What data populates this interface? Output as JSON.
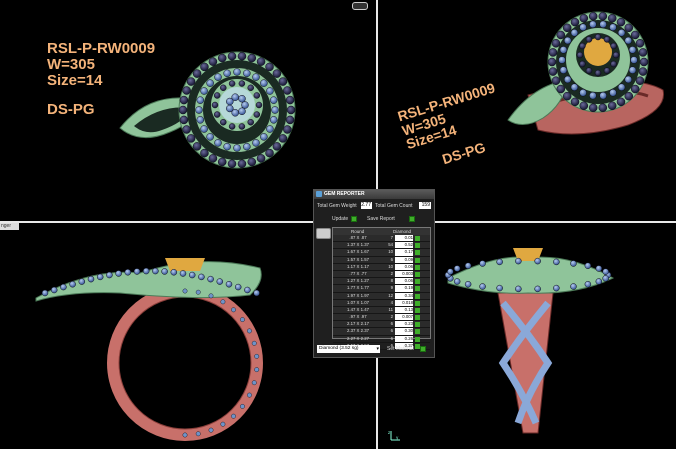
{
  "labels": {
    "topleft": {
      "code": "RSL-P-RW0009",
      "weight": "W=305",
      "size": "Size=14",
      "ds": "DS-PG"
    },
    "topright": {
      "code": "RSL-P-RW0009",
      "weight": "W=305",
      "size": "Size=14",
      "ds": "DS-PG"
    }
  },
  "viewport_tag": "nger",
  "axis_icon": "axis-gizmo",
  "gem_reporter": {
    "title": "GEM REPORTER",
    "total_weight_label": "Total Gem Weight",
    "total_weight_value": "2.77",
    "total_count_label": "Total Gem Count",
    "total_count_value": "159",
    "update_label": "Update",
    "save_report_label": "Save Report",
    "table_header_shape": "Round",
    "table_header_material": "Diamond",
    "rows": [
      {
        "size": ".87 X .87",
        "count": "7",
        "weight": "0.01"
      },
      {
        "size": "1.37 X 1.37",
        "count": "54",
        "weight": "0.52"
      },
      {
        "size": "1.67 X 1.67",
        "count": "10",
        "weight": "0.17"
      },
      {
        "size": "1.57 X 1.57",
        "count": "6",
        "weight": "0.09"
      },
      {
        "size": "1.17 X 1.17",
        "count": "10",
        "weight": "0.06"
      },
      {
        "size": ".77 X .77",
        "count": "2",
        "weight": "0.003"
      },
      {
        "size": "1.27 X 1.27",
        "count": "8",
        "weight": "0.06"
      },
      {
        "size": "1.77 X 1.77",
        "count": "9",
        "weight": "0.19"
      },
      {
        "size": "1.97 X 1.97",
        "count": "12",
        "weight": "0.34"
      },
      {
        "size": "1.07 X 1.07",
        "count": "4",
        "weight": "0.018"
      },
      {
        "size": "1.47 X 1.47",
        "count": "11",
        "weight": "0.13"
      },
      {
        "size": ".97 X .97",
        "count": "2",
        "weight": "0.007"
      },
      {
        "size": "2.17 X 2.17",
        "count": "6",
        "weight": "0.23"
      },
      {
        "size": "2.37 X 2.37",
        "count": "6",
        "weight": "0.30"
      },
      {
        "size": "2.27 X 2.27",
        "count": "6",
        "weight": "0.26"
      },
      {
        "size": "2.57 X 2.57",
        "count": "6",
        "weight": "0.37"
      }
    ],
    "material_select": "Diamond   (3.52 sg)",
    "set_material_label": "Set Material"
  },
  "colors": {
    "label": "#f4b37a",
    "metal_green": "#a8d8a8",
    "metal_rose": "#c8706a",
    "gold": "#e0a840",
    "gem_blue": "#6f93c8",
    "gem_dark": "#2a2a50"
  }
}
